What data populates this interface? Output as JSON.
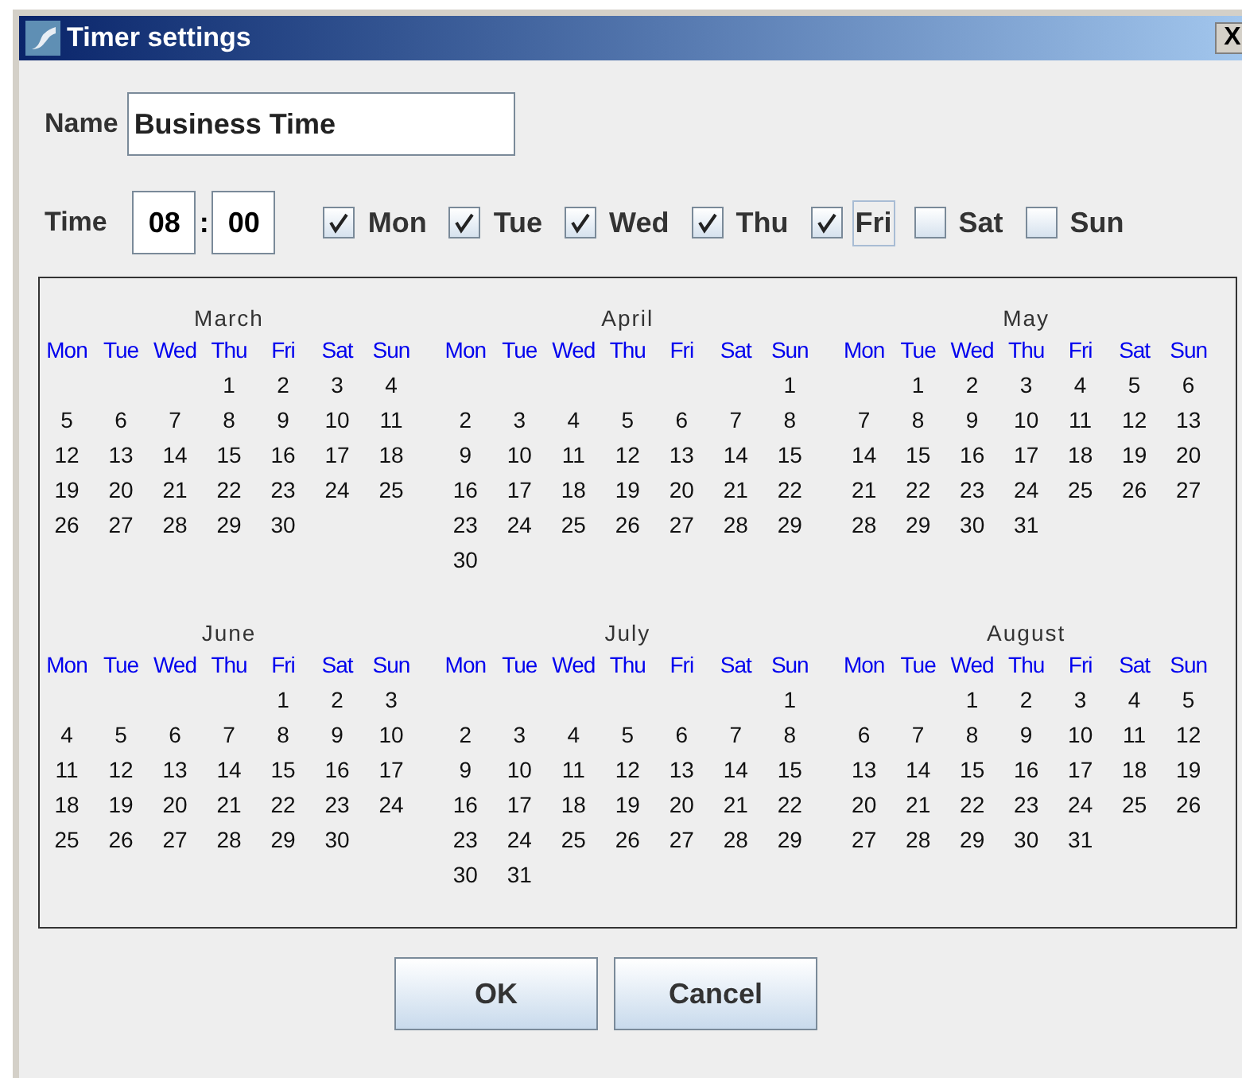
{
  "window": {
    "title": "Timer settings",
    "close": "X"
  },
  "name_label": "Name",
  "name_value": "Business Time",
  "time_label": "Time",
  "hours": "08",
  "separator": ":",
  "minutes": "00",
  "days": [
    {
      "label": "Mon",
      "checked": true,
      "focused": false
    },
    {
      "label": "Tue",
      "checked": true,
      "focused": false
    },
    {
      "label": "Wed",
      "checked": true,
      "focused": false
    },
    {
      "label": "Thu",
      "checked": true,
      "focused": false
    },
    {
      "label": "Fri",
      "checked": true,
      "focused": true
    },
    {
      "label": "Sat",
      "checked": false,
      "focused": false
    },
    {
      "label": "Sun",
      "checked": false,
      "focused": false
    }
  ],
  "months": [
    {
      "name": "March",
      "weekdays": [
        "Mon",
        "Tue",
        "Wed",
        "Thu",
        "Fri",
        "Sat",
        "Sun"
      ],
      "weeks": [
        [
          "1",
          "2",
          "3",
          "4"
        ],
        [
          "5",
          "6",
          "7",
          "8",
          "9",
          "10",
          "11"
        ],
        [
          "12",
          "13",
          "14",
          "15",
          "16",
          "17",
          "18"
        ],
        [
          "19",
          "20",
          "21",
          "22",
          "23",
          "24",
          "25"
        ],
        [
          "26",
          "27",
          "28",
          "29",
          "30"
        ]
      ]
    },
    {
      "name": "April",
      "weekdays": [
        "Mon",
        "Tue",
        "Wed",
        "Thu",
        "Fri",
        "Sat",
        "Sun"
      ],
      "weeks": [
        [
          "1"
        ],
        [
          "2",
          "3",
          "4",
          "5",
          "6",
          "7",
          "8"
        ],
        [
          "9",
          "10",
          "11",
          "12",
          "13",
          "14",
          "15"
        ],
        [
          "16",
          "17",
          "18",
          "19",
          "20",
          "21",
          "22"
        ],
        [
          "23",
          "24",
          "25",
          "26",
          "27",
          "28",
          "29"
        ],
        [
          "30"
        ]
      ]
    },
    {
      "name": "May",
      "weekdays": [
        "Mon",
        "Tue",
        "Wed",
        "Thu",
        "Fri",
        "Sat",
        "Sun"
      ],
      "weeks": [
        [
          "1",
          "2",
          "3",
          "4",
          "5",
          "6"
        ],
        [
          "7",
          "8",
          "9",
          "10",
          "11",
          "12",
          "13"
        ],
        [
          "14",
          "15",
          "16",
          "17",
          "18",
          "19",
          "20"
        ],
        [
          "21",
          "22",
          "23",
          "24",
          "25",
          "26",
          "27"
        ],
        [
          "28",
          "29",
          "30",
          "31"
        ]
      ]
    },
    {
      "name": "June",
      "weekdays": [
        "Mon",
        "Tue",
        "Wed",
        "Thu",
        "Fri",
        "Sat",
        "Sun"
      ],
      "weeks": [
        [
          "1",
          "2",
          "3"
        ],
        [
          "4",
          "5",
          "6",
          "7",
          "8",
          "9",
          "10"
        ],
        [
          "11",
          "12",
          "13",
          "14",
          "15",
          "16",
          "17"
        ],
        [
          "18",
          "19",
          "20",
          "21",
          "22",
          "23",
          "24"
        ],
        [
          "25",
          "26",
          "27",
          "28",
          "29",
          "30"
        ]
      ]
    },
    {
      "name": "July",
      "weekdays": [
        "Mon",
        "Tue",
        "Wed",
        "Thu",
        "Fri",
        "Sat",
        "Sun"
      ],
      "weeks": [
        [
          "1"
        ],
        [
          "2",
          "3",
          "4",
          "5",
          "6",
          "7",
          "8"
        ],
        [
          "9",
          "10",
          "11",
          "12",
          "13",
          "14",
          "15"
        ],
        [
          "16",
          "17",
          "18",
          "19",
          "20",
          "21",
          "22"
        ],
        [
          "23",
          "24",
          "25",
          "26",
          "27",
          "28",
          "29"
        ],
        [
          "30",
          "31"
        ]
      ]
    },
    {
      "name": "August",
      "weekdays": [
        "Mon",
        "Tue",
        "Wed",
        "Thu",
        "Fri",
        "Sat",
        "Sun"
      ],
      "weeks": [
        [
          "1",
          "2",
          "3",
          "4",
          "5"
        ],
        [
          "6",
          "7",
          "8",
          "9",
          "10",
          "11",
          "12"
        ],
        [
          "13",
          "14",
          "15",
          "16",
          "17",
          "18",
          "19"
        ],
        [
          "20",
          "21",
          "22",
          "23",
          "24",
          "25",
          "26"
        ],
        [
          "27",
          "28",
          "29",
          "30",
          "31"
        ]
      ]
    }
  ],
  "buttons": [
    "OK",
    "Cancel"
  ]
}
